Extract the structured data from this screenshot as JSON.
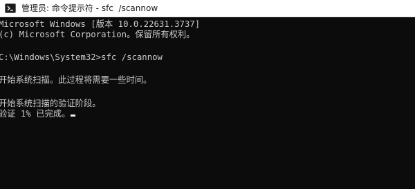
{
  "window": {
    "title": "管理员: 命令提示符 - sfc  /scannow",
    "icon": "command-prompt-icon"
  },
  "console": {
    "lines": [
      "Microsoft Windows [版本 10.0.22631.3737]",
      "(c) Microsoft Corporation。保留所有权利。",
      "C:\\Windows\\System32>sfc /scannow",
      "开始系统扫描。此过程将需要一些时间。",
      "开始系统扫描的验证阶段。",
      "验证 1% 已完成。"
    ]
  },
  "colors": {
    "background": "#0c0c0c",
    "foreground": "#cccccc",
    "titlebar": "#ffffff"
  }
}
